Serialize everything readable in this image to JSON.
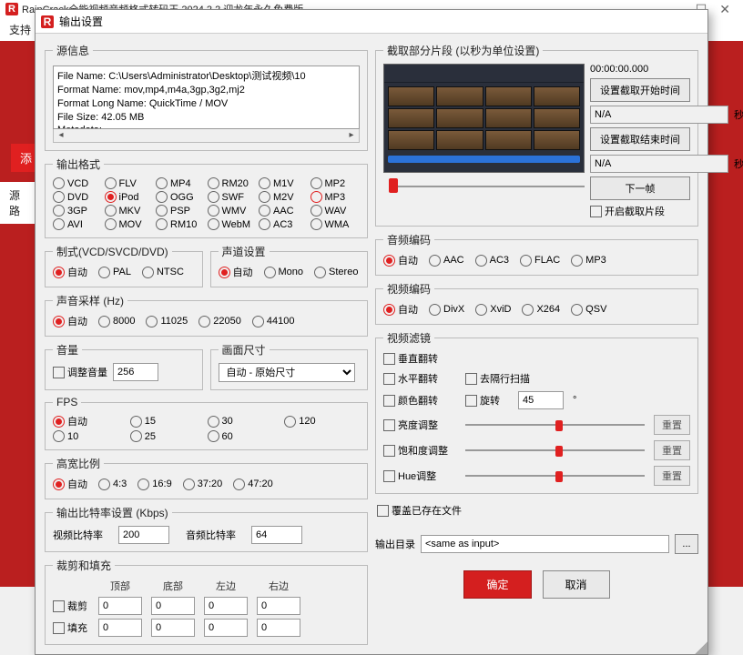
{
  "bg": {
    "app_title": "RainCrack全能视频音频格式转码王 2024 2.2 迎龙年永久免费版",
    "tab_support": "支持",
    "btn_add": "添",
    "tab_src": "源路"
  },
  "dlg": {
    "title": "输出设置"
  },
  "src": {
    "legend": "源信息",
    "lines": [
      "File Name: C:\\Users\\Administrator\\Desktop\\测试视频\\10",
      "Format Name: mov,mp4,m4a,3gp,3g2,mj2",
      "Format Long Name: QuickTime / MOV",
      "File Size: 42.05 MB",
      "Metadata:"
    ]
  },
  "fmt": {
    "legend": "输出格式",
    "items": [
      "VCD",
      "FLV",
      "MP4",
      "RM20",
      "M1V",
      "MP2",
      "DVD",
      "iPod",
      "OGG",
      "SWF",
      "M2V",
      "MP3",
      "3GP",
      "MKV",
      "PSP",
      "WMV",
      "AAC",
      "WAV",
      "AVI",
      "MOV",
      "RM10",
      "WebM",
      "AC3",
      "WMA"
    ],
    "selected": "iPod",
    "mp3_marked": "MP3"
  },
  "std": {
    "legend": "制式(VCD/SVCD/DVD)",
    "items": [
      "自动",
      "PAL",
      "NTSC"
    ],
    "selected": "自动"
  },
  "ch": {
    "legend": "声道设置",
    "items": [
      "自动",
      "Mono",
      "Stereo"
    ],
    "selected": "自动"
  },
  "sr": {
    "legend": "声音采样 (Hz)",
    "items": [
      "自动",
      "8000",
      "11025",
      "22050",
      "44100"
    ],
    "selected": "自动"
  },
  "vol": {
    "legend": "音量",
    "chk": "调整音量",
    "value": "256"
  },
  "size": {
    "legend": "画面尺寸",
    "value": "自动 - 原始尺寸"
  },
  "fps": {
    "legend": "FPS",
    "items": [
      "自动",
      "15",
      "30",
      "120",
      "10",
      "25",
      "60"
    ],
    "selected": "自动"
  },
  "ar": {
    "legend": "高宽比例",
    "items": [
      "自动",
      "4:3",
      "16:9",
      "37:20",
      "47:20"
    ],
    "selected": "自动"
  },
  "br": {
    "legend": "输出比特率设置 (Kbps)",
    "vlabel": "视频比特率",
    "vval": "200",
    "alabel": "音频比特率",
    "aval": "64"
  },
  "crop": {
    "legend": "裁剪和填充",
    "hdr": [
      "顶部",
      "底部",
      "左边",
      "右边"
    ],
    "chk_crop": "裁剪",
    "chk_pad": "填充",
    "vals": [
      "0",
      "0",
      "0",
      "0"
    ]
  },
  "seg": {
    "legend": "截取部分片段 (以秒为单位设置)",
    "time": "00:00:00.000",
    "btn_start": "设置截取开始时间",
    "start_val": "N/A",
    "btn_end": "设置截取结束时间",
    "end_val": "N/A",
    "sec": "秒",
    "btn_next": "下一帧",
    "chk_enable": "开启截取片段"
  },
  "aenc": {
    "legend": "音频编码",
    "items": [
      "自动",
      "AAC",
      "AC3",
      "FLAC",
      "MP3"
    ],
    "selected": "自动"
  },
  "venc": {
    "legend": "视频编码",
    "items": [
      "自动",
      "DivX",
      "XviD",
      "X264",
      "QSV"
    ],
    "selected": "自动"
  },
  "flt": {
    "legend": "视频滤镜",
    "chk_vflip": "垂直翻转",
    "chk_hflip": "水平翻转",
    "chk_cflip": "颜色翻转",
    "chk_deint": "去隔行扫描",
    "chk_rot": "旋转",
    "rot_val": "45",
    "rot_deg": "°",
    "chk_bright": "亮度调整",
    "chk_sat": "饱和度调整",
    "chk_hue": "Hue调整",
    "reset": "重置"
  },
  "ow": {
    "label": "覆盖已存在文件"
  },
  "out": {
    "label": "输出目录",
    "value": "<same as input>"
  },
  "btns": {
    "ok": "确定",
    "cancel": "取消"
  }
}
